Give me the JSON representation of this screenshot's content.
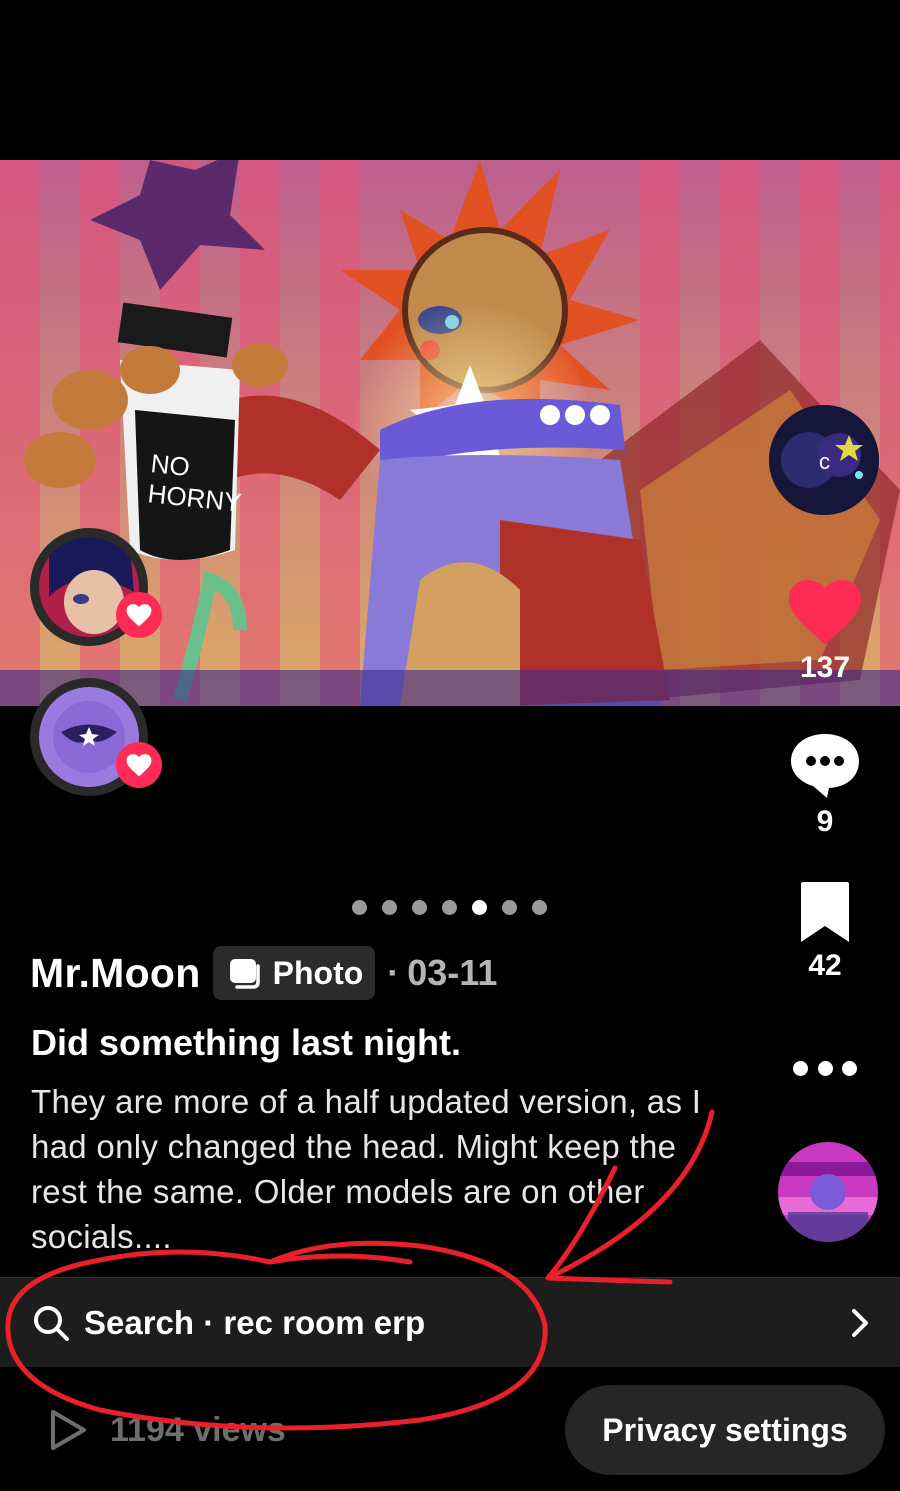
{
  "media": {
    "kind": "photo-carousel",
    "sign_text_line1": "NO",
    "sign_text_line2": "HORNY",
    "page_count": 7,
    "active_page_index": 4
  },
  "actions": {
    "likes": "137",
    "comments": "9",
    "saves": "42"
  },
  "icons": {
    "like": "heart-icon",
    "comment": "comment-bubble-icon",
    "save": "bookmark-icon",
    "more": "more-dots-icon",
    "search": "search-icon",
    "chevron": "chevron-right-icon",
    "views": "play-icon",
    "photo": "photo-stack-icon"
  },
  "post": {
    "author": "Mr.Moon",
    "type_label": "Photo",
    "date_separator": "·",
    "date": "03-11",
    "title": "Did something last night.",
    "body": "They are more of a half updated version, as I had only changed the head. Might keep the rest the same. Older models are on other socials...."
  },
  "search": {
    "text": "Search · rec room erp"
  },
  "footer": {
    "views": "1194 views",
    "privacy_button": "Privacy settings"
  },
  "colors": {
    "accent_red": "#fe2c55",
    "annotation_red": "#e8202a",
    "background": "#000000"
  }
}
